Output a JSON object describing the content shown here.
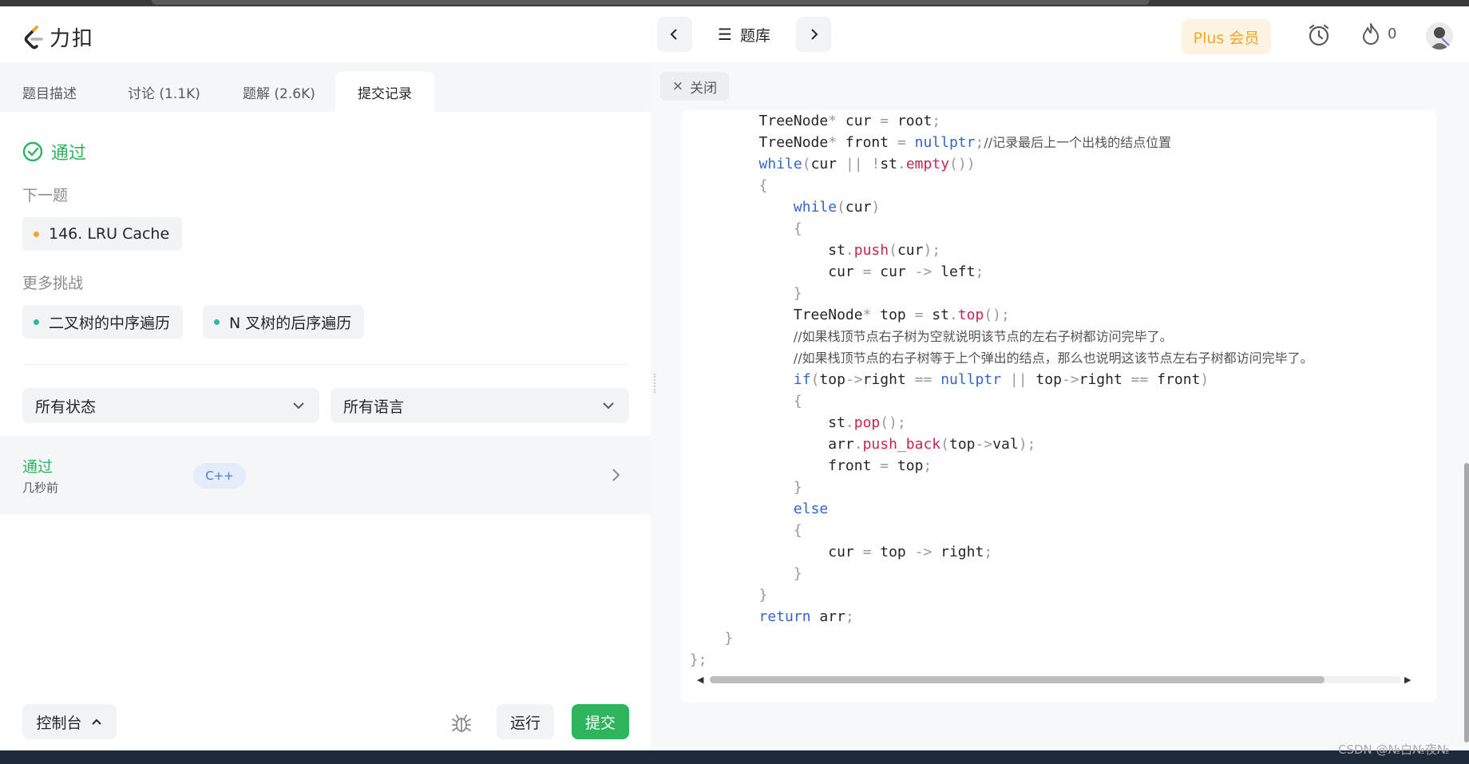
{
  "app": {
    "logo_text": "力扣"
  },
  "nav": {
    "problem_list_label": "题库",
    "plus_label": "Plus 会员",
    "streak_count": "0"
  },
  "tabs": [
    {
      "label": "题目描述"
    },
    {
      "label": "讨论 (1.1K)"
    },
    {
      "label": "题解 (2.6K)"
    },
    {
      "label": "提交记录"
    }
  ],
  "result": {
    "status": "通过",
    "next_label": "下一题",
    "next_problem": "146. LRU Cache",
    "more_label": "更多挑战",
    "challenges": [
      "二叉树的中序遍历",
      "N 叉树的后序遍历"
    ]
  },
  "filters": {
    "status": "所有状态",
    "language": "所有语言"
  },
  "submission": {
    "status": "通过",
    "time": "几秒前",
    "language": "C++"
  },
  "actions": {
    "console": "控制台",
    "run": "运行",
    "submit": "提交"
  },
  "editor": {
    "close_label": "关闭"
  },
  "watermark": "CSDN @№白№夜№",
  "colors": {
    "accent_green": "#2db55d",
    "plus_orange": "#f5a623",
    "keyword_blue": "#3366cc",
    "method_red": "#c7254e"
  }
}
